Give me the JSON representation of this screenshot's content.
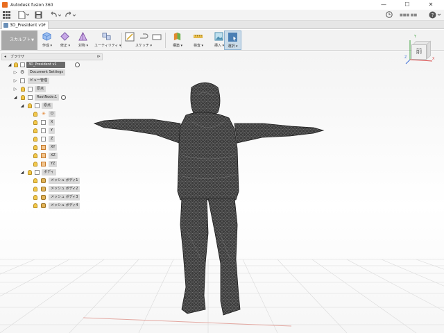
{
  "window": {
    "title": "Autodesk fusion 360",
    "controls": [
      "—",
      "☐",
      "✕"
    ]
  },
  "qat": {
    "user": "■■■ ■■",
    "help": "?"
  },
  "tab": {
    "label": "3D_President v1*",
    "close": "×"
  },
  "ribbon": {
    "workspace": "スカルプト",
    "groups": [
      "作成 ▾",
      "修正 ▾",
      "対称 ▾",
      "ユーティリティ ▾",
      "スケッチ ▾",
      "構築 ▾",
      "検査 ▾",
      "挿入 ▾",
      "選択 ▾"
    ],
    "colors": {
      "create": "#5b8cd6",
      "modify": "#7a58a8",
      "symmetry": "#8457a6",
      "utility": "#6b7fa8",
      "sketch": "#6a6a6a",
      "construct": "#e18a2f",
      "inspect": "#d4a21f",
      "insert": "#4d8fb0",
      "select": "#4a7fb4"
    }
  },
  "browser": {
    "title": "ブラウザ",
    "root": "3D_President v1",
    "items": {
      "doc_settings": "Document Settings",
      "views": "ビュー管理",
      "origin_top": "原点",
      "rootnode": "RootNode:1",
      "origin": "原点",
      "o": "O",
      "x": "X",
      "y": "Y",
      "z": "Z",
      "xy": "XY",
      "xz": "XZ",
      "yz": "YZ",
      "bodies": "ボディ",
      "mesh1": "メッシュ ボディ1",
      "mesh2": "メッシュ ボディ2",
      "mesh3": "メッシュ ボディ3",
      "mesh4": "メッシュ ボディ4"
    }
  },
  "viewcube": {
    "front": "前",
    "axis_y": "Y",
    "axis_x": "X",
    "axis_z": "Z",
    "colors": {
      "x": "#d84a4a",
      "y": "#3da33d",
      "z": "#3f6fd6"
    }
  }
}
